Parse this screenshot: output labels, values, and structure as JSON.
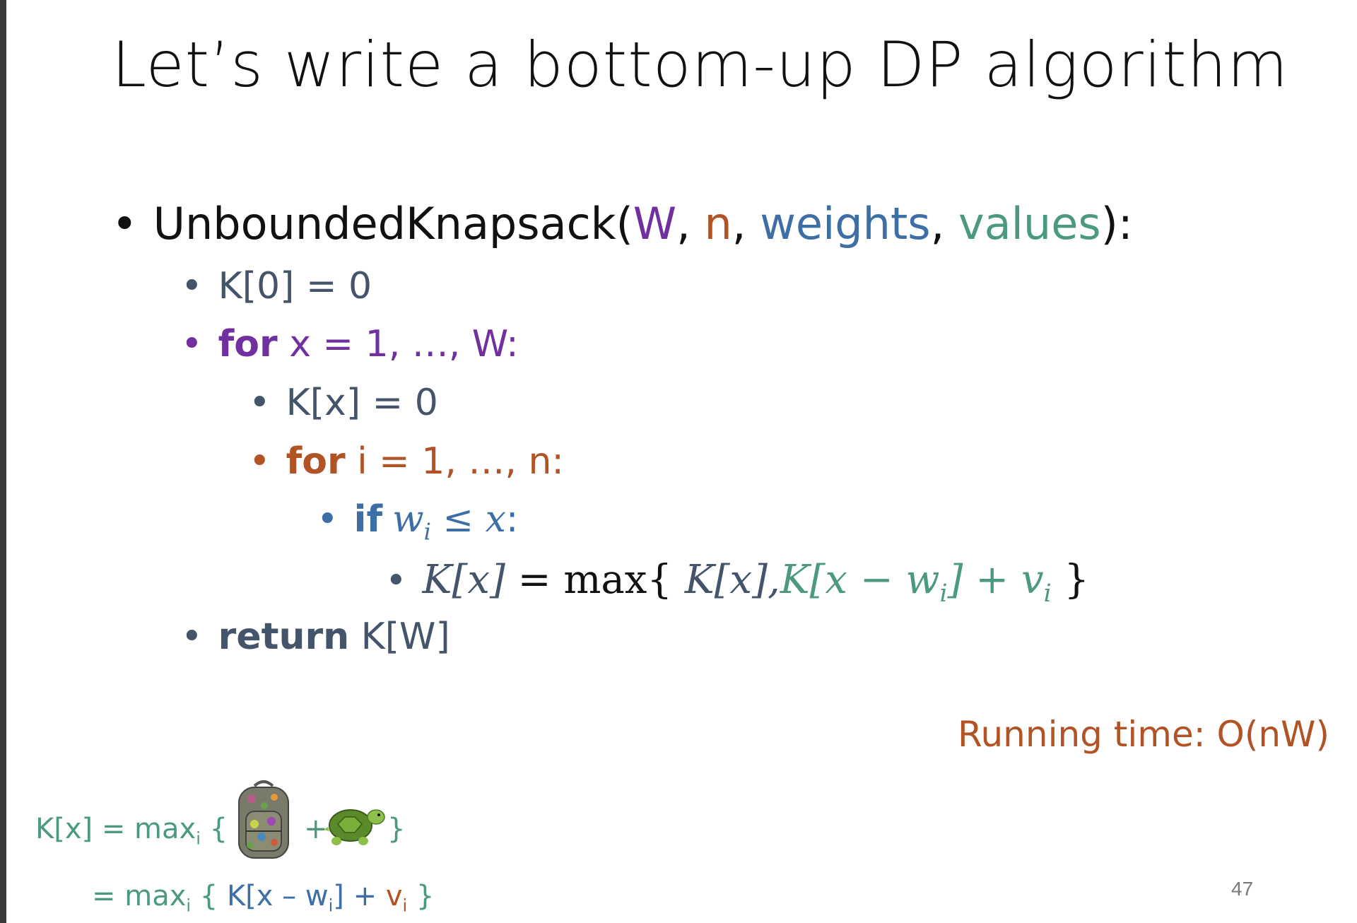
{
  "colors": {
    "title": "#111111",
    "purple": "#7030a0",
    "orange": "#b25325",
    "blue": "#3d6fa6",
    "green": "#4c9a7e",
    "slate": "#44546a",
    "black": "#111111"
  },
  "slide": {
    "title": "Let’s write a bottom-up DP algorithm",
    "page_number": "47",
    "running_time": "Running time: O(nW)"
  },
  "algorithm": {
    "header": {
      "bullet": "•",
      "name": "UnboundedKnapsack(",
      "p1": "W",
      "c1": ", ",
      "p2": "n",
      "c2": ", ",
      "p3": "weights",
      "c3": ", ",
      "p4": "values",
      "close": "):"
    },
    "line1": {
      "bullet": "•",
      "text": "K[0] = 0"
    },
    "line2": {
      "bullet": "•",
      "kw": "for",
      "text": " x = 1, …, W:"
    },
    "line3": {
      "bullet": "•",
      "text": "K[x] = 0"
    },
    "line4": {
      "bullet": "•",
      "kw": "for",
      "text": " i = 1, …, n:"
    },
    "line5": {
      "bullet": "•",
      "kw": "if",
      "w": "w",
      "i": "i",
      "rel": " ≤ ",
      "x": "x",
      "colon": ":"
    },
    "line6": {
      "bullet": "•",
      "lhs": "K[x]",
      "eq": " = max{ ",
      "t1": "K[x],",
      "t2a": "K[x  − w",
      "t2i": "i",
      "t2b": "] + ",
      "v": "v",
      "vi": "i",
      "close": " }"
    },
    "line7": {
      "bullet": "•",
      "kw": "return",
      "text": " K[W]"
    }
  },
  "footnote": {
    "line1": {
      "a": "K[x] = max",
      "sub": "i",
      "b": " {",
      "plus": "+",
      "close": "}"
    },
    "line2": {
      "a": "= max",
      "sub": "i",
      "b": " { ",
      "c": "K[x – w",
      "ci": "i",
      "d": "] + ",
      "e": "v",
      "ei": "i",
      "f": " }"
    },
    "images": {
      "backpack": "backpack-illustration",
      "turtle": "turtle-emoji"
    }
  }
}
